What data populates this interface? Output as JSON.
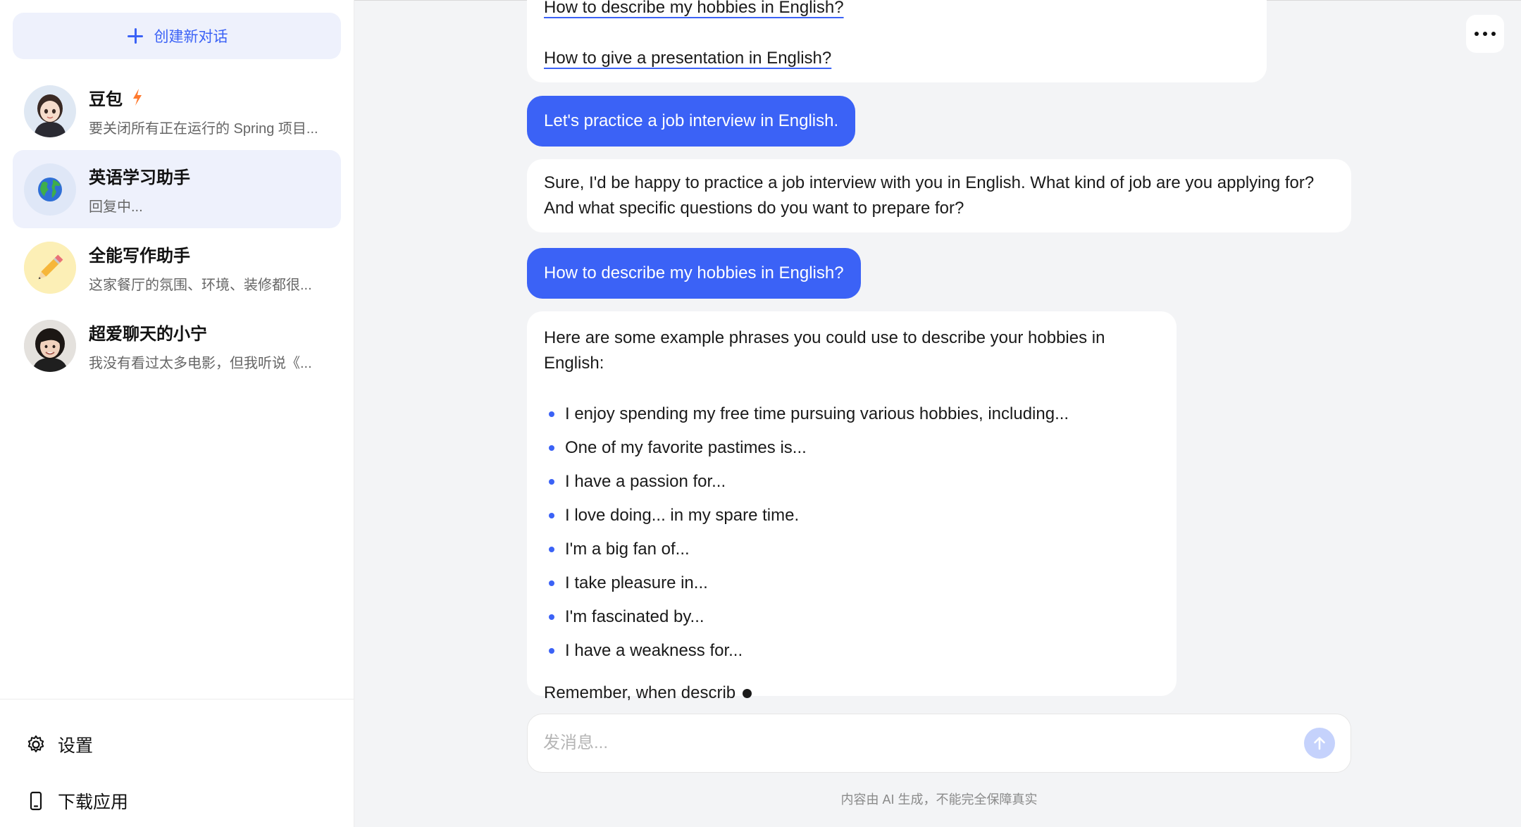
{
  "sidebar": {
    "new_chat_label": "创建新对话",
    "conversations": [
      {
        "name": "豆包",
        "preview": "要关闭所有正在运行的 Spring 项目...",
        "avatar": "girl-avatar",
        "badge": "lightning-icon"
      },
      {
        "name": "英语学习助手",
        "preview": "回复中...",
        "avatar": "globe-avatar",
        "active": true
      },
      {
        "name": "全能写作助手",
        "preview": "这家餐厅的氛围、环境、装修都很...",
        "avatar": "pencil-avatar"
      },
      {
        "name": "超爱聊天的小宁",
        "preview": "我没有看过太多电影，但我听说《...",
        "avatar": "woman-avatar"
      }
    ],
    "footer": {
      "settings_label": "设置",
      "download_label": "下载应用"
    }
  },
  "chat": {
    "suggestions": [
      "How to describe my hobbies in English?",
      "How to give a presentation in English?"
    ],
    "messages": [
      {
        "role": "user",
        "text": "Let's practice a job interview in English."
      },
      {
        "role": "assistant",
        "lines": [
          "Sure, I'd be happy to practice a job interview with you in English. What kind of job are you applying for?",
          "And what specific questions do you want to prepare for?"
        ]
      },
      {
        "role": "user",
        "text": "How to describe my hobbies in English?"
      },
      {
        "role": "assistant",
        "intro": "Here are some example phrases you could use to describe your hobbies in English:",
        "bullets": [
          "I enjoy spending my free time pursuing various hobbies, including...",
          "One of my favorite pastimes is...",
          "I have a passion for...",
          "I love doing... in my spare time.",
          "I'm a big fan of...",
          "I take pleasure in...",
          "I'm fascinated by...",
          "I have a weakness for..."
        ],
        "streaming_text": "Remember, when describ"
      }
    ],
    "input_placeholder": "发消息...",
    "disclaimer": "内容由 AI 生成，不能完全保障真实"
  },
  "colors": {
    "accent": "#3b62f6",
    "user_bubble": "#3b62f6",
    "active_conv_bg": "#eef1fc",
    "main_bg": "#f3f4f6"
  }
}
